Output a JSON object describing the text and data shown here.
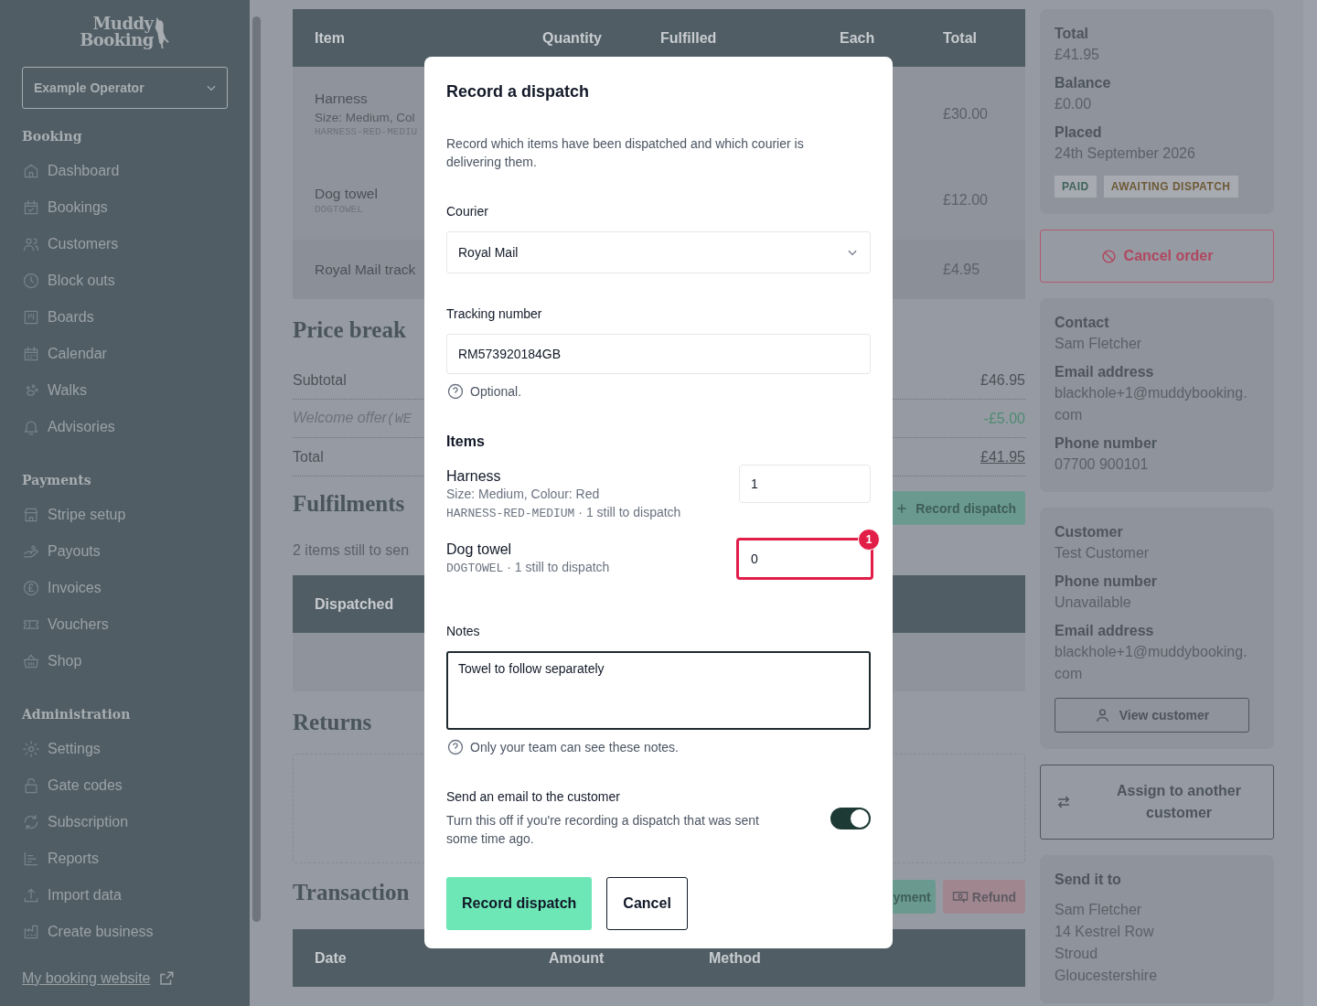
{
  "sidebar": {
    "logo": [
      "Muddy",
      "Booking"
    ],
    "operator_select": {
      "value": "Example Operator"
    },
    "sections": [
      {
        "title": "Booking",
        "items": [
          {
            "label": "Dashboard"
          },
          {
            "label": "Bookings"
          },
          {
            "label": "Customers"
          },
          {
            "label": "Block outs"
          },
          {
            "label": "Boards"
          },
          {
            "label": "Calendar"
          },
          {
            "label": "Walks"
          },
          {
            "label": "Advisories"
          }
        ]
      },
      {
        "title": "Payments",
        "items": [
          {
            "label": "Stripe setup"
          },
          {
            "label": "Payouts"
          },
          {
            "label": "Invoices"
          },
          {
            "label": "Vouchers"
          },
          {
            "label": "Shop"
          }
        ]
      },
      {
        "title": "Administration",
        "items": [
          {
            "label": "Settings"
          },
          {
            "label": "Gate codes"
          },
          {
            "label": "Subscription"
          },
          {
            "label": "Reports"
          },
          {
            "label": "Import data"
          },
          {
            "label": "Create business"
          }
        ]
      }
    ],
    "footer_link": "My booking website"
  },
  "order_table": {
    "columns": [
      "Item",
      "Quantity",
      "Fulfilled",
      "Each",
      "Total"
    ],
    "rows": [
      {
        "name": "Harness",
        "detail": "Size: Medium, Col",
        "sku": "HARNESS-RED-MEDIU",
        "total": "£30.00"
      },
      {
        "name": "Dog towel",
        "sku": "DOGTOWEL",
        "total": "£12.00"
      },
      {
        "name": "Royal Mail track",
        "total": "£4.95"
      }
    ]
  },
  "price_breakdown": {
    "title": "Price break",
    "rows": [
      {
        "kind": "plain",
        "label": "Subtotal",
        "value": "£46.95"
      },
      {
        "kind": "discount",
        "label": "Welcome offer",
        "code": "(WE",
        "value": "-£5.00"
      },
      {
        "kind": "total",
        "label": "Total",
        "value": "£41.95"
      }
    ]
  },
  "fulfilments": {
    "title": "Fulfilments",
    "action": "Record dispatch",
    "summary": "2 items still to sen",
    "table_header": "Dispatched"
  },
  "returns": {
    "title": "Returns"
  },
  "transactions": {
    "title": "Transaction",
    "actions": [
      {
        "kind": "payment",
        "label": "yment"
      },
      {
        "kind": "refund",
        "label": "Refund"
      }
    ],
    "columns": [
      "Date",
      "Amount",
      "Method"
    ]
  },
  "order_summary": {
    "fields": [
      {
        "label": "Total",
        "value": "£41.95"
      },
      {
        "label": "Balance",
        "value": "£0.00"
      },
      {
        "label": "Placed",
        "value": "24th September 2026"
      }
    ],
    "badges": [
      {
        "text": "PAID",
        "color": "#3f6358"
      },
      {
        "text": "AWAITING DISPATCH",
        "color": "#6e5a36"
      }
    ]
  },
  "cancel_button": "Cancel order",
  "contact": {
    "fields": [
      {
        "label": "Contact",
        "value": "Sam Fletcher"
      },
      {
        "label": "Email address",
        "value": "blackhole+1@muddybooking.com"
      },
      {
        "label": "Phone number",
        "value": "07700 900101"
      }
    ]
  },
  "customer": {
    "fields": [
      {
        "label": "Customer",
        "value": "Test Customer"
      },
      {
        "label": "Phone number",
        "value": "Unavailable"
      },
      {
        "label": "Email address",
        "value": "blackhole+1@muddybooking.com"
      }
    ],
    "button": "View customer"
  },
  "assign_button": "Assign to another customer",
  "shipping": {
    "title": "Send it to",
    "lines": [
      "Sam Fletcher",
      "14 Kestrel Row",
      "Stroud",
      "Gloucestershire"
    ]
  },
  "modal": {
    "title": "Record a dispatch",
    "description": "Record which items have been dispatched and which courier is delivering them.",
    "courier": {
      "label": "Courier",
      "value": "Royal Mail"
    },
    "tracking": {
      "label": "Tracking number",
      "value": "RM573920184GB",
      "help": "Optional."
    },
    "items": {
      "title": "Items",
      "rows": [
        {
          "name": "Harness",
          "detail": "Size: Medium, Colour: Red",
          "sku": "HARNESS-RED-MEDIUM",
          "remaining": "· 1 still to dispatch",
          "quantity": "1",
          "invalid": false
        },
        {
          "name": "Dog towel",
          "sku": "DOGTOWEL",
          "remaining": "· 1 still to dispatch",
          "quantity": "0",
          "invalid": true,
          "error_count": "1"
        }
      ]
    },
    "notes": {
      "label": "Notes",
      "value": "Towel to follow separately",
      "help": "Only your team can see these notes."
    },
    "email_toggle": {
      "label": "Send an email to the customer",
      "hint": "Turn this off if you're recording a dispatch that was sent some time ago.",
      "on": true
    },
    "buttons": [
      {
        "kind": "primary",
        "label": "Record dispatch"
      },
      {
        "kind": "secondary",
        "label": "Cancel"
      }
    ]
  }
}
